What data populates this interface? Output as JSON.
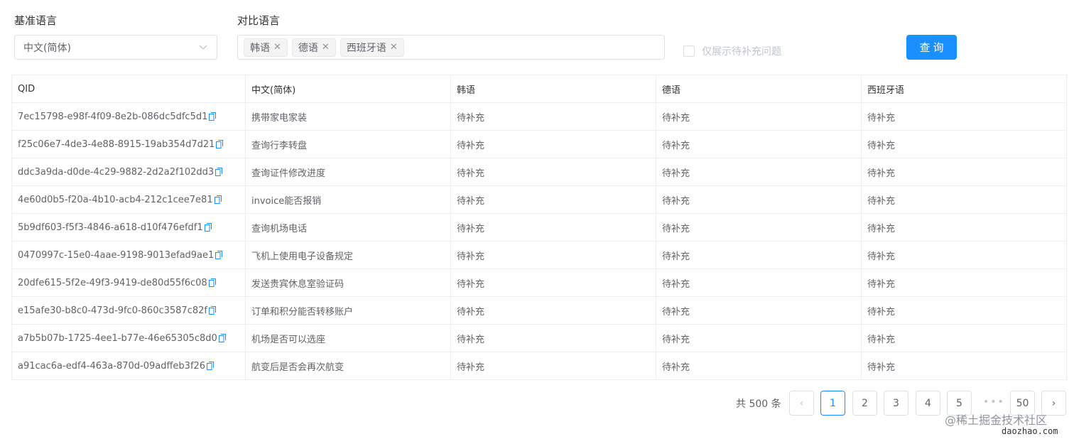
{
  "filters": {
    "base_label": "基准语言",
    "base_value": "中文(简体)",
    "compare_label": "对比语言",
    "compare_tags": [
      "韩语",
      "德语",
      "西班牙语"
    ],
    "only_pending_label": "仅展示待补充问题",
    "query_button": "查询"
  },
  "table": {
    "headers": [
      "QID",
      "中文(简体)",
      "韩语",
      "德语",
      "西班牙语"
    ],
    "rows": [
      {
        "qid": "7ec15798-e98f-4f09-8e2b-086dc5dfc5d1",
        "zh": "携带家电家装",
        "ko": "待补充",
        "de": "待补充",
        "es": "待补充"
      },
      {
        "qid": "f25c06e7-4de3-4e88-8915-19ab354d7d21",
        "zh": "查询行李转盘",
        "ko": "待补充",
        "de": "待补充",
        "es": "待补充"
      },
      {
        "qid": "ddc3a9da-d0de-4c29-9882-2d2a2f102dd3",
        "zh": "查询证件修改进度",
        "ko": "待补充",
        "de": "待补充",
        "es": "待补充"
      },
      {
        "qid": "4e60d0b5-f20a-4b10-acb4-212c1cee7e81",
        "zh": "invoice能否报销",
        "ko": "待补充",
        "de": "待补充",
        "es": "待补充"
      },
      {
        "qid": "5b9df603-f5f3-4846-a618-d10f476efdf1",
        "zh": "查询机场电话",
        "ko": "待补充",
        "de": "待补充",
        "es": "待补充"
      },
      {
        "qid": "0470997c-15e0-4aae-9198-9013efad9ae1",
        "zh": "飞机上使用电子设备规定",
        "ko": "待补充",
        "de": "待补充",
        "es": "待补充"
      },
      {
        "qid": "20dfe615-5f2e-49f3-9419-de80d55f6c08",
        "zh": "发送贵宾休息室验证码",
        "ko": "待补充",
        "de": "待补充",
        "es": "待补充"
      },
      {
        "qid": "e15afe30-b8c0-473d-9fc0-860c3587c82f",
        "zh": "订单和积分能否转移账户",
        "ko": "待补充",
        "de": "待补充",
        "es": "待补充"
      },
      {
        "qid": "a7b5b07b-1725-4ee1-b77e-46e65305c8d0",
        "zh": "机场是否可以选座",
        "ko": "待补充",
        "de": "待补充",
        "es": "待补充"
      },
      {
        "qid": "a91cac6a-edf4-463a-870d-09adffeb3f26",
        "zh": "航变后是否会再次航变",
        "ko": "待补充",
        "de": "待补充",
        "es": "待补充"
      }
    ]
  },
  "pagination": {
    "total": "共 500 条",
    "pages": [
      "1",
      "2",
      "3",
      "4",
      "5"
    ],
    "ellipsis": "•••",
    "last": "50",
    "prev": "‹",
    "next": "›"
  },
  "watermark": {
    "line1": "@稀土掘金技术社区",
    "line2": "daozhao.com"
  },
  "colors": {
    "primary": "#1890ff",
    "link": "#1e6fc9"
  }
}
